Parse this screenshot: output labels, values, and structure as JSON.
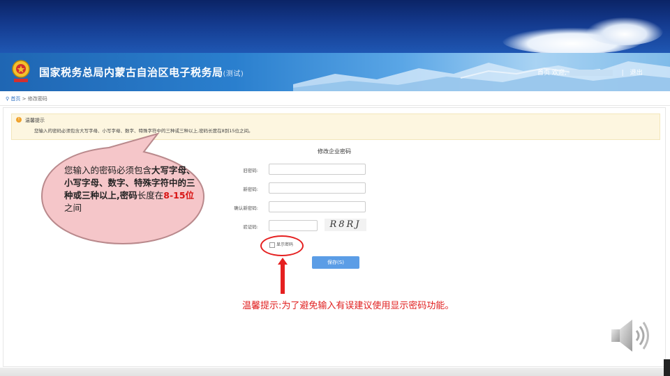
{
  "header": {
    "title": "国家税务总局内蒙古自治区电子税务局",
    "title_suffix": "(测试)",
    "nav": {
      "home": "首页",
      "welcome": "欢迎,",
      "logout": "退出"
    }
  },
  "breadcrumb": {
    "home": "首页",
    "separator": ">",
    "current": "修改密码"
  },
  "notice": {
    "title": "温馨提示",
    "text": "您输入的密码必须包含大写字母、小写字母、数字、特殊字符中的三种或三种以上,密码长度在8到15位之间。"
  },
  "form": {
    "title": "修改企业密码",
    "old_password_label": "旧密码:",
    "new_password_label": "新密码:",
    "confirm_password_label": "确认新密码:",
    "captcha_label": "验证码:",
    "captcha_text": "R8RJ",
    "show_password_label": "显示密码",
    "save_label": "保存(S)"
  },
  "callout": {
    "part1": "您输入的密码必须包含",
    "part2": "大写字母、小写字母、数字、特殊字符中的三种或三种以上,密码",
    "part3": "长度在",
    "part4": "8-15位",
    "part5": "之间"
  },
  "tip_annotation": "温馨提示:为了避免输入有误建议使用显示密码功能。",
  "colors": {
    "accent_red": "#e01e1e",
    "button_blue": "#5b9de6",
    "notice_bg": "#fdf6e0"
  },
  "icons": [
    "tax-emblem-icon",
    "location-pin-icon",
    "notice-icon",
    "speaker-icon"
  ]
}
